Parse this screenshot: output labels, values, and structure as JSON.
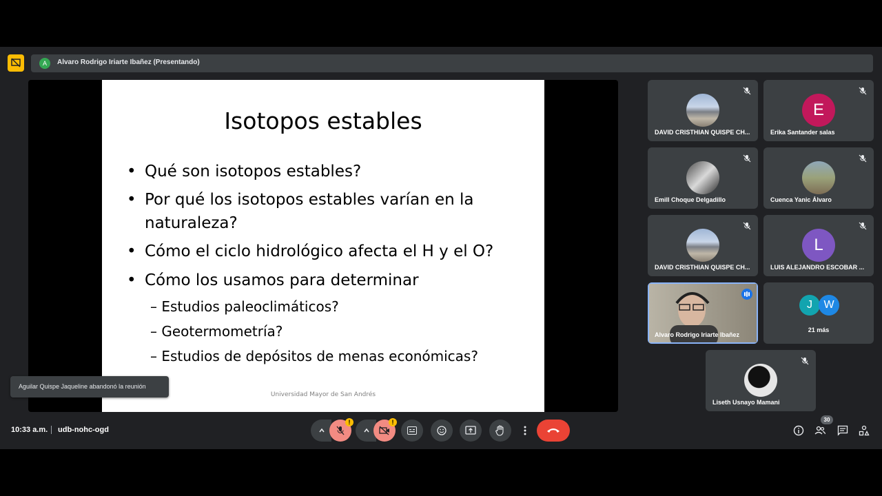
{
  "presenter_bar": {
    "avatar_letter": "A",
    "label": "Alvaro Rodrigo Iriarte Ibañez (Presentando)"
  },
  "slide": {
    "title": "Isotopos estables",
    "bullets": [
      "Qué son isotopos estables?",
      "Por qué los isotopos estables varían en la",
      "naturaleza?",
      "Cómo el ciclo hidrológico afecta el H y el O?",
      "Cómo los usamos para determinar"
    ],
    "sub_bullets": [
      "– Estudios paleoclimáticos?",
      "– Geotermometría?",
      "– Estudios de depósitos de menas económicas?"
    ],
    "footer": "Universidad Mayor de San Andrés"
  },
  "participants": [
    {
      "name": "DAVID CRISTHIAN QUISPE CH...",
      "muted": true
    },
    {
      "name": "Erika Santander salas",
      "letter": "E",
      "color": "#c2185b",
      "muted": true
    },
    {
      "name": "Emill Choque Delgadillo",
      "muted": true
    },
    {
      "name": "Cuenca Yanic Álvaro",
      "muted": true
    },
    {
      "name": "DAVID CRISTHIAN QUISPE CH...",
      "muted": true
    },
    {
      "name": "LUIS ALEJANDRO ESCOBAR ...",
      "letter": "L",
      "color": "#7e57c2",
      "muted": true
    },
    {
      "name": "Alvaro Rodrigo Iriarte Ibañez",
      "speaking": true
    },
    {
      "more_letters": [
        "J",
        "W"
      ],
      "more_label": "21 más"
    },
    {
      "name": "Liseth Usnayo Mamani",
      "muted": true
    }
  ],
  "toast": "Aguilar Quispe Jaqueline abandonó la reunión",
  "bottom_bar": {
    "time": "10:33 a.m.",
    "meeting_code": "udb-nohc-ogd",
    "warning_mark": "!",
    "people_count": "30"
  },
  "colors": {
    "end_call": "#ea4335",
    "presenting": "#fbbc04",
    "mic_off_bg": "#f28b82",
    "accent": "#8ab4f8"
  }
}
